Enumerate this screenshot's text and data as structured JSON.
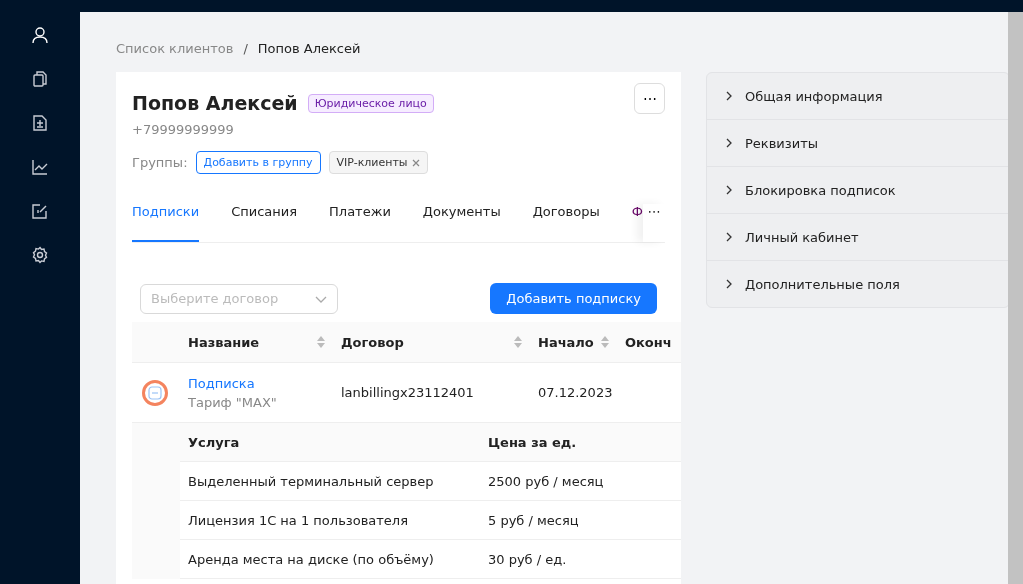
{
  "sidebar": {
    "items": [
      {
        "kind": "user",
        "selected": true
      },
      {
        "kind": "documents",
        "selected": false
      },
      {
        "kind": "document-add",
        "selected": false
      },
      {
        "kind": "chart",
        "selected": false
      },
      {
        "kind": "edit",
        "selected": false
      },
      {
        "kind": "settings",
        "selected": false
      }
    ]
  },
  "breadcrumb": [
    "Список клиентов",
    "Попов Алексей"
  ],
  "breadcrumb_separator": "/",
  "client": {
    "name": "Попов Алексей",
    "type_badge": "Юридическое лицо",
    "phone": "+79999999999",
    "more_button": "⋯",
    "groups_label": "Группы:",
    "add_group_button": "Добавить в группу",
    "groups": [
      {
        "label": "VIP-клиенты"
      }
    ]
  },
  "tabs": [
    {
      "label": "Подписки",
      "selected": true
    },
    {
      "label": "Списания",
      "selected": false
    },
    {
      "label": "Платежи",
      "selected": false
    },
    {
      "label": "Документы",
      "selected": false
    },
    {
      "label": "Договоры",
      "selected": false
    },
    {
      "label": "Ф",
      "selected": false
    }
  ],
  "tabs_more": "⋯",
  "contract_select": {
    "placeholder": "Выберите договор"
  },
  "add_subscription_button": "Добавить подписку",
  "table": {
    "columns": [
      "Название",
      "Договор",
      "Начало",
      "Оконч"
    ],
    "rows": [
      {
        "expanded": true,
        "name": "Подписка",
        "tariff": "Тариф \"MAX\"",
        "contract": "lanbillingx23112401",
        "start": "07.12.2023",
        "services": {
          "columns": [
            "Услуга",
            "Цена за ед."
          ],
          "rows": [
            [
              "Выделенный терминальный сервер",
              "2500 руб / месяц"
            ],
            [
              "Лицензия 1С на 1 пользователя",
              "5 руб / месяц"
            ],
            [
              "Аренда места на диске (по объёму)",
              "30 руб / ед."
            ]
          ]
        }
      }
    ]
  },
  "accordion": [
    {
      "label": "Общая информация",
      "expanded": false
    },
    {
      "label": "Реквизиты",
      "expanded": false
    },
    {
      "label": "Блокировка подписок",
      "expanded": false
    },
    {
      "label": "Личный кабинет",
      "expanded": false
    },
    {
      "label": "Дополнительные поля",
      "expanded": false
    }
  ]
}
